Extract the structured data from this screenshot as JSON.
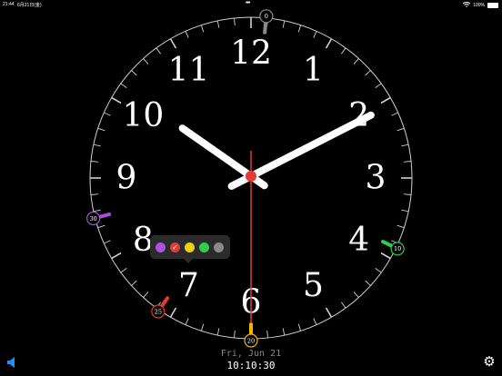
{
  "status_bar": {
    "time": "21:44",
    "date": "6月21日(金)",
    "dots": "•••",
    "battery": "100%"
  },
  "clock": {
    "numerals": [
      "12",
      "1",
      "2",
      "3",
      "4",
      "5",
      "6",
      "7",
      "8",
      "9",
      "10",
      "11"
    ],
    "hour": 10,
    "minute": 10,
    "second": 30,
    "colors": {
      "hand": "#ffffff",
      "second_hand": "#e53935",
      "center": "#e53935",
      "ticks": "#cfcfcf"
    }
  },
  "markers": [
    {
      "label": "0",
      "minute": 0.9,
      "color": "#8a8a8a"
    },
    {
      "label": "10",
      "minute": 19.3,
      "color": "#2ecc4f"
    },
    {
      "label": "20",
      "minute": 30.0,
      "color": "#f5b400"
    },
    {
      "label": "25",
      "minute": 35.8,
      "color": "#e53935"
    },
    {
      "label": "30",
      "minute": 42.6,
      "color": "#a64ed6"
    }
  ],
  "color_picker": {
    "swatches": [
      {
        "name": "purple",
        "color": "#b04fe8",
        "selected": false
      },
      {
        "name": "red",
        "color": "#e53935",
        "selected": true
      },
      {
        "name": "yellow",
        "color": "#f5d000",
        "selected": false
      },
      {
        "name": "green",
        "color": "#2ecc4f",
        "selected": false
      },
      {
        "name": "gray",
        "color": "#8a8a8a",
        "selected": false
      }
    ],
    "check": "✓"
  },
  "footer": {
    "date": "Fri, Jun 21",
    "time": "10:10:30",
    "speaker_icon": "speaker-icon",
    "gear_icon": "gear-icon",
    "gear_glyph": "⚙",
    "accent": "#1e90ff"
  }
}
